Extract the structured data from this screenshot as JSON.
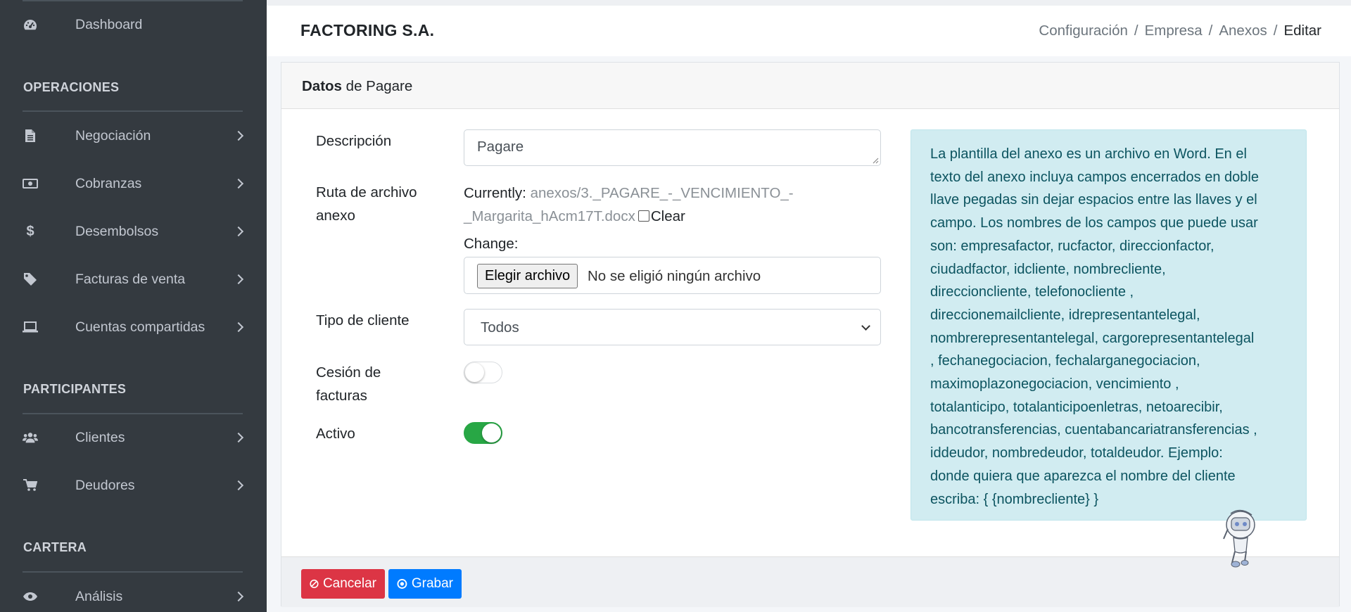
{
  "sidebar": {
    "dashboard": "Dashboard",
    "sections": {
      "operaciones": "OPERACIONES",
      "participantes": "PARTICIPANTES",
      "cartera": "CARTERA"
    },
    "items": [
      {
        "label": "Negociación",
        "icon": "file-icon"
      },
      {
        "label": "Cobranzas",
        "icon": "money-icon"
      },
      {
        "label": "Desembolsos",
        "icon": "dollar-icon"
      },
      {
        "label": "Facturas de venta",
        "icon": "tag-icon"
      },
      {
        "label": "Cuentas compartidas",
        "icon": "laptop-icon"
      },
      {
        "label": "Clientes",
        "icon": "users-icon"
      },
      {
        "label": "Deudores",
        "icon": "cart-icon"
      },
      {
        "label": "Análisis",
        "icon": "eye-icon"
      }
    ]
  },
  "header": {
    "brand": "FACTORING S.A.",
    "breadcrumb": [
      "Configuración",
      "Empresa",
      "Anexos",
      "Editar"
    ]
  },
  "card": {
    "title_bold": "Datos",
    "title_rest": " de Pagare"
  },
  "form": {
    "descripcion_label": "Descripción",
    "descripcion_value": "Pagare",
    "ruta_label_1": "Ruta de archivo",
    "ruta_label_2": "anexo",
    "currently_label": "Currently:",
    "currently_file_1": "anexos/3._PAGARE_-_VENCIMIENTO_-",
    "currently_file_2": "_Margarita_hAcm17T.docx",
    "clear_label": "Clear",
    "change_label": "Change:",
    "file_button": "Elegir archivo",
    "file_status": "No se eligió ningún archivo",
    "tipo_label": "Tipo de cliente",
    "tipo_value": "Todos",
    "cesion_label_1": "Cesión de",
    "cesion_label_2": "facturas",
    "cesion_on": false,
    "activo_label": "Activo",
    "activo_on": true
  },
  "info": {
    "lines": [
      "La plantilla del anexo es un archivo en Word. En el",
      "texto del anexo incluya campos encerrados en doble",
      "llave pegadas sin dejar espacios entre las llaves y el",
      "campo. Los nombres de los campos que puede usar",
      "son: empresafactor, rucfactor, direccionfactor,",
      "ciudadfactor, idcliente, nombrecliente,",
      "direccioncliente, telefonocliente ,",
      "direccionemailcliente, idrepresentantelegal,",
      "nombrerepresentantelegal, cargorepresentantelegal",
      ", fechanegociacion, fechalarganegociacion,",
      "maximoplazonegociacion, vencimiento ,",
      "totalanticipo, totalanticipoenletras, netoarecibir,",
      "bancotransferencias, cuentabancariatransferencias ,",
      "iddeudor, nombredeudor, totaldeudor. Ejemplo:",
      "donde quiera que aparezca el nombre del cliente",
      "escriba: { {nombrecliente} }"
    ]
  },
  "footer": {
    "cancel": "Cancelar",
    "save": "Grabar"
  },
  "colors": {
    "sidebar_bg": "#343a40",
    "info_bg": "#d1ecf1",
    "cancel": "#dc3545",
    "save": "#007bff",
    "toggle_on": "#28a745"
  }
}
